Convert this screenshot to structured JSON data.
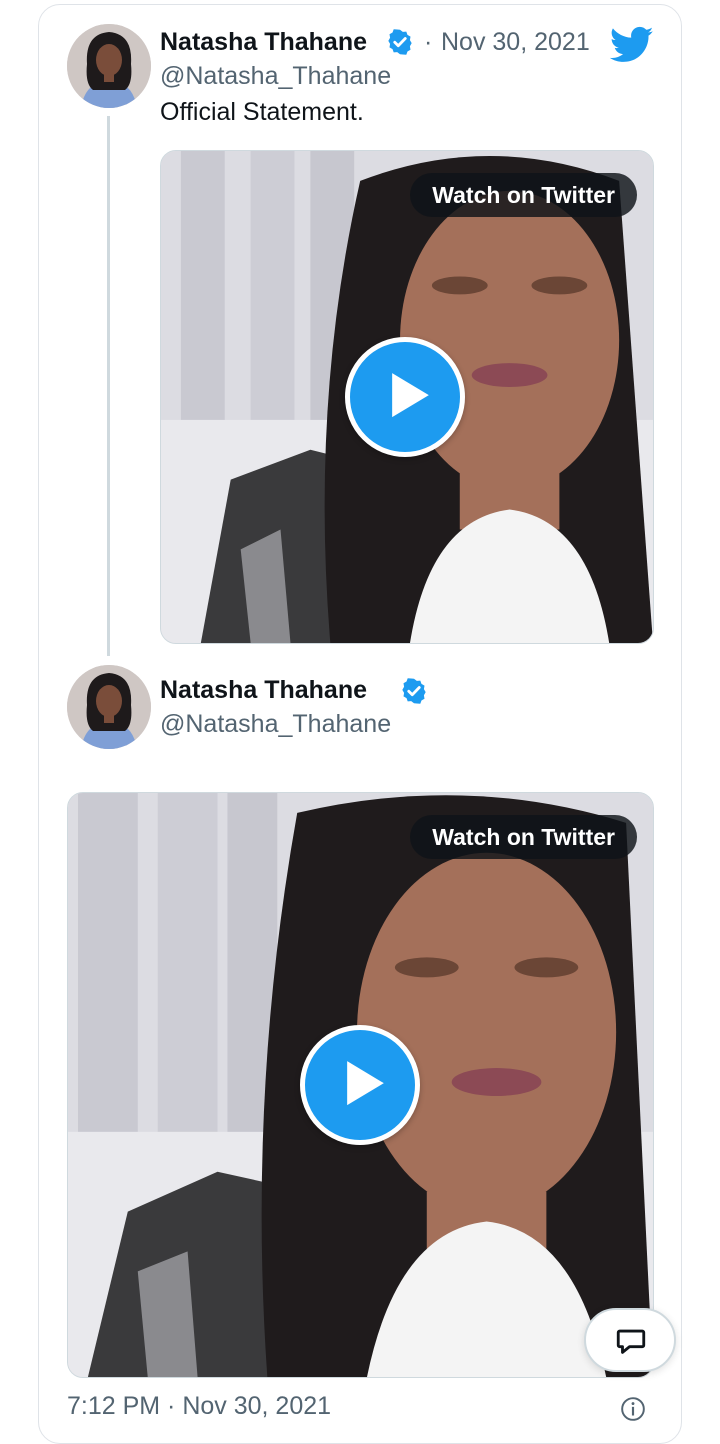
{
  "tweet": {
    "author_name": "Natasha Thahane",
    "author_handle": "@Natasha_Thahane",
    "date_separator": "·",
    "date": "Nov 30, 2021",
    "text": "Official Statement.",
    "media": {
      "watch_label": "Watch on Twitter",
      "play_icon": "play-icon"
    }
  },
  "quoted": {
    "author_name": "Natasha Thahane",
    "author_handle": "@Natasha_Thahane",
    "media": {
      "watch_label": "Watch on Twitter",
      "play_icon": "play-icon"
    }
  },
  "footer": {
    "timestamp": "7:12 PM · Nov 30, 2021"
  },
  "icons": {
    "logo": "twitter-bird-icon",
    "verified": "verified-badge-icon",
    "info": "info-icon",
    "reply": "reply-icon"
  },
  "colors": {
    "accent": "#1d9bf0",
    "text": "#0f1419",
    "secondary_text": "#536471",
    "border": "#cfd9de"
  }
}
